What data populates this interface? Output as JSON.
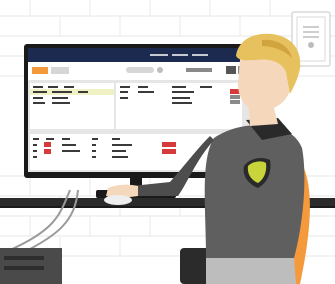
{
  "scene": {
    "colors": {
      "background": "#ffffff",
      "brick_lines": "#ececec",
      "wall_panel_border": "#d8d8d8",
      "monitor_frame": "#1a1a1a",
      "screen_header": "#1b2a4e",
      "screen_body": "#e6e6e6",
      "app_topbar": "#ffffff",
      "orange_accent": "#f29a3a",
      "highlight_row": "#f1f1c6",
      "red_cell": "#d63a3a",
      "desk": "#2b2b2b",
      "mouse": "#eeeeee",
      "skin": "#f5d8bc",
      "hair": "#e8c15f",
      "hair_shadow": "#d2a43f",
      "shirt": "#5f5f5f",
      "shirt_dark": "#4d4d4d",
      "collar": "#2a2a2a",
      "badge_fill": "#c9d43a",
      "chair": "#f59a3c",
      "pants": "#bdbdbd",
      "cpu_tower": "#4a4a4a",
      "cable": "#9a9a9a"
    },
    "monitor": {
      "rows": 8,
      "status_cell_color_name": "red",
      "highlighted_row_index": 0
    },
    "icons": [
      "monitor-icon",
      "mouse-icon",
      "shield-badge-icon",
      "wall-outlet-icon"
    ]
  }
}
